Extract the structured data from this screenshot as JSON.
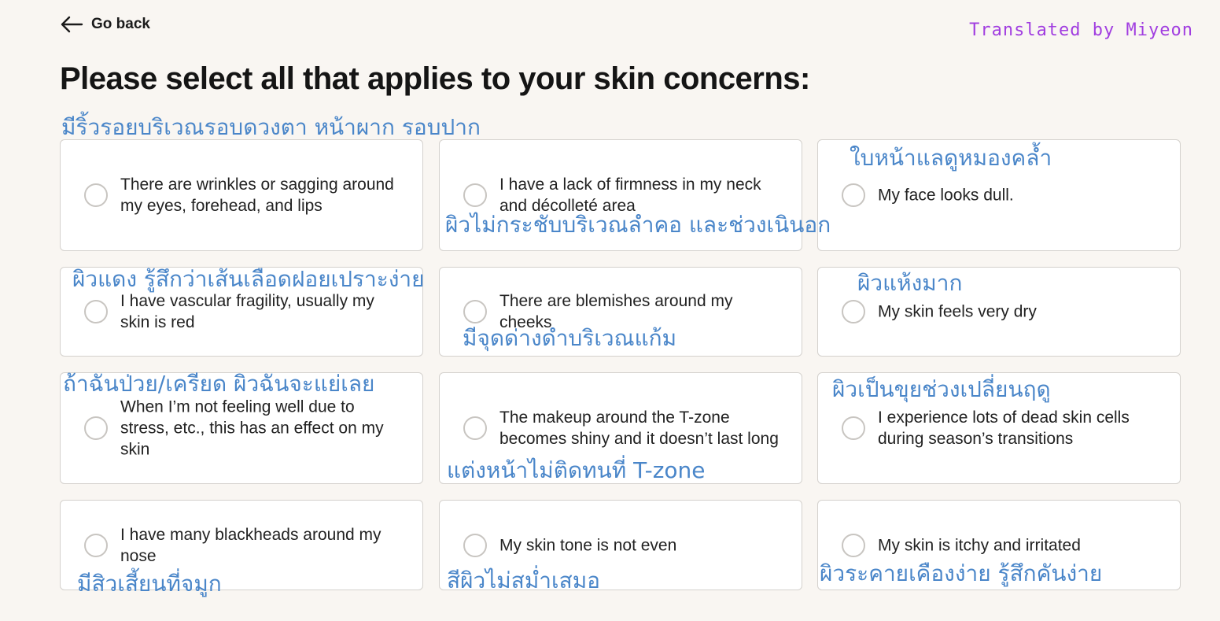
{
  "nav": {
    "back_label": "Go back"
  },
  "credit": "Translated  by  Miyeon",
  "page_title": "Please select all that applies to your skin concerns:",
  "options": [
    {
      "label": "There are wrinkles or sagging around my eyes, forehead, and lips",
      "note": "มีริ้วรอยบริเวณรอบดวงตา  หน้าผาก  รอบปาก"
    },
    {
      "label": "I have a lack of firmness in my neck and décolleté area",
      "note": "ผิวไม่กระชับบริเวณลำคอ  และช่วงเนินอก"
    },
    {
      "label": "My face looks dull.",
      "note": "ใบหน้าแลดูหมองคล้ำ"
    },
    {
      "label": "I have vascular fragility, usually my skin is red",
      "note": "ผิวแดง  รู้สึกว่าเส้นเลือดฝอยเปราะง่าย"
    },
    {
      "label": "There are blemishes around my cheeks",
      "note": "มีจุดด่างดำบริเวณแก้ม"
    },
    {
      "label": "My skin feels very dry",
      "note": "ผิวแห้งมาก"
    },
    {
      "label": "When I’m not feeling well due to stress, etc., this has an effect on my skin",
      "note": "ถ้าฉันป่วย/เครียด  ผิวฉันจะแย่เลย"
    },
    {
      "label": "The makeup around the T-zone becomes shiny and it doesn’t last long",
      "note": "แต่งหน้าไม่ติดทนที่  T-zone"
    },
    {
      "label": "I experience lots of dead skin cells during season’s transitions",
      "note": "ผิวเป็นขุยช่วงเปลี่ยนฤดู"
    },
    {
      "label": "I have many blackheads around my nose",
      "note": "มีสิวเสี้ยนที่จมูก"
    },
    {
      "label": "My skin tone is not even",
      "note": "สีผิวไม่สม่ำเสมอ"
    },
    {
      "label": "My skin is itchy and irritated",
      "note": "ผิวระคายเคืองง่าย  รู้สึกคันง่าย"
    }
  ],
  "colors": {
    "background": "#f9f6f2",
    "card": "#ffffff",
    "note_blue": "#4a86c9",
    "credit_purple": "#a13ee0"
  },
  "icons": {
    "back": "arrow-left-icon",
    "option": "radio-circle-icon"
  }
}
